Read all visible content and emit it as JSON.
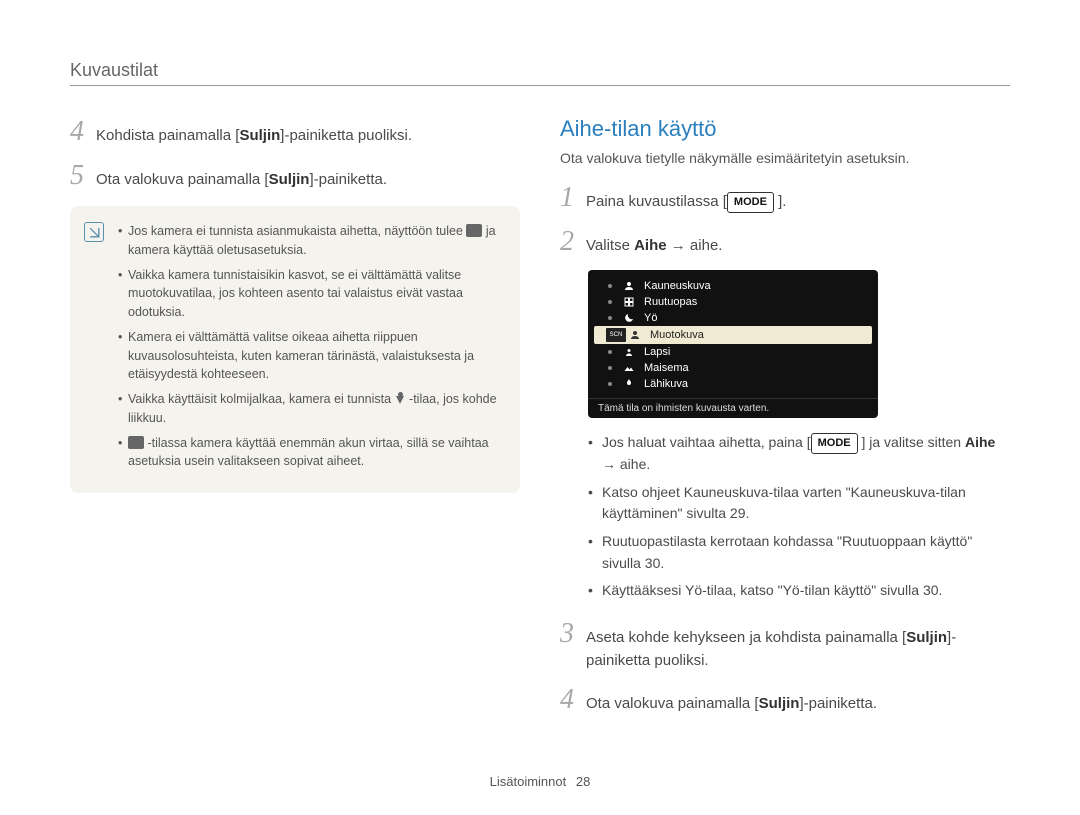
{
  "section_title": "Kuvaustilat",
  "left": {
    "steps": [
      {
        "num": "4",
        "pre": "Kohdista painamalla [",
        "bold": "Suljin",
        "post": "]-painiketta puoliksi."
      },
      {
        "num": "5",
        "pre": "Ota valokuva painamalla [",
        "bold": "Suljin",
        "post": "]-painiketta."
      }
    ],
    "info": [
      {
        "t1": "Jos kamera ei tunnista asianmukaista aihetta, näyttöön tulee ",
        "t2": " ja kamera käyttää oletusasetuksia."
      },
      {
        "t": "Vaikka kamera tunnistaisikin kasvot, se ei välttämättä valitse muotokuvatilaa, jos kohteen asento tai valaistus eivät vastaa odotuksia."
      },
      {
        "t": "Kamera ei välttämättä valitse oikeaa aihetta riippuen kuvausolosuhteista, kuten kameran tärinästä, valaistuksesta ja etäisyydestä kohteeseen."
      },
      {
        "t1": "Vaikka käyttäisit kolmijalkaa, kamera ei tunnista ",
        "t2": "-tilaa, jos kohde liikkuu."
      },
      {
        "t1": "",
        "t2": " -tilassa kamera käyttää enemmän akun virtaa, sillä se vaihtaa asetuksia usein valitakseen sopivat aiheet."
      }
    ]
  },
  "right": {
    "heading": "Aihe-tilan käyttö",
    "intro": "Ota valokuva tietylle näkymälle esimääritetyin asetuksin.",
    "step1": {
      "num": "1",
      "pre": "Paina kuvaustilassa [",
      "btn": "MODE",
      "post": " ]."
    },
    "step2": {
      "num": "2",
      "pre": "Valitse ",
      "bold": "Aihe",
      "post": " → aihe."
    },
    "lcd": {
      "items": [
        {
          "label": "Kauneuskuva"
        },
        {
          "label": "Ruutuopas"
        },
        {
          "label": "Yö"
        },
        {
          "label": "Muotokuva",
          "selected": true
        },
        {
          "label": "Lapsi"
        },
        {
          "label": "Maisema"
        },
        {
          "label": "Lähikuva"
        }
      ],
      "bar": "Tämä tila on ihmisten kuvausta varten."
    },
    "bullets": [
      {
        "t1": "Jos haluat vaihtaa aihetta, paina [",
        "btn": "MODE",
        "t2": " ] ja valitse sitten ",
        "bold": "Aihe",
        "t3": " → aihe."
      },
      {
        "t": "Katso ohjeet Kauneuskuva-tilaa varten \"Kauneuskuva-tilan käyttäminen\" sivulta 29."
      },
      {
        "t": " Ruutuopastilasta kerrotaan kohdassa \"Ruutuoppaan käyttö\" sivulla 30."
      },
      {
        "t": "Käyttääksesi Yö-tilaa, katso \"Yö-tilan käyttö\" sivulla 30."
      }
    ],
    "step3": {
      "num": "3",
      "pre": "Aseta kohde kehykseen ja kohdista painamalla [",
      "bold": "Suljin",
      "post": "]-painiketta puoliksi."
    },
    "step4": {
      "num": "4",
      "pre": "Ota valokuva painamalla [",
      "bold": "Suljin",
      "post": "]-painiketta."
    }
  },
  "footer": {
    "label": "Lisätoiminnot",
    "page": "28"
  }
}
